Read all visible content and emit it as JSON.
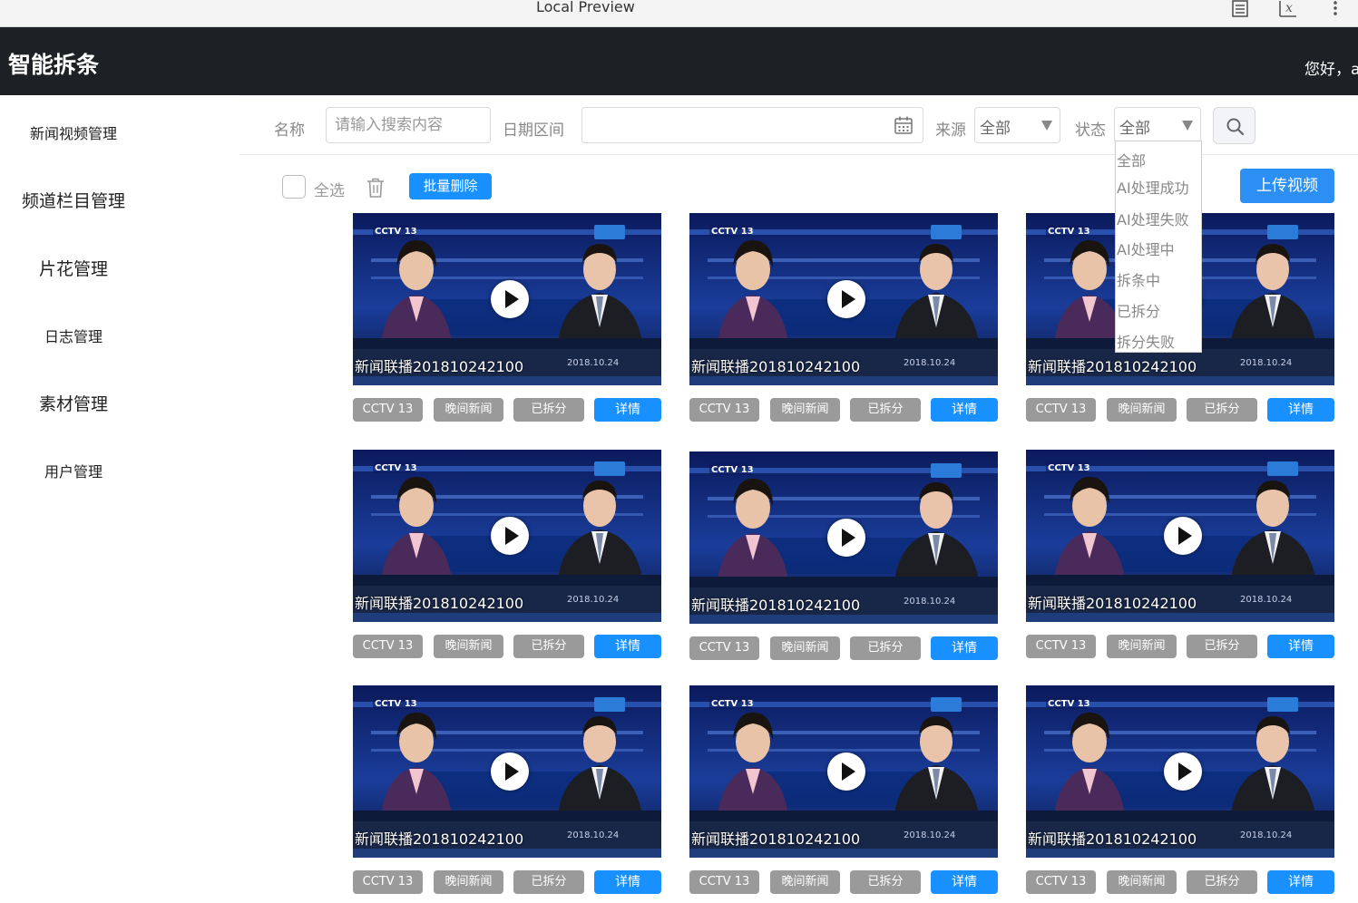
{
  "window": {
    "title": "Local Preview"
  },
  "header": {
    "brand": "智能拆条",
    "greeting": "您好，a"
  },
  "sidebar": {
    "items": [
      {
        "label": "新闻视频管理"
      },
      {
        "label": "频道栏目管理"
      },
      {
        "label": "片花管理"
      },
      {
        "label": "日志管理"
      },
      {
        "label": "素材管理"
      },
      {
        "label": "用户管理"
      }
    ]
  },
  "filters": {
    "name_label": "名称",
    "name_placeholder": "请输入搜索内容",
    "date_label": "日期区间",
    "source_label": "来源",
    "source_value": "全部",
    "status_label": "状态",
    "status_value": "全部",
    "status_options": [
      "全部",
      "AI处理成功",
      "AI处理失败",
      "AI处理中",
      "拆条中",
      "已拆分",
      "拆分失败"
    ]
  },
  "toolbar": {
    "select_all": "全选",
    "batch_delete": "批量删除",
    "upload": "上传视频"
  },
  "videos": [
    {
      "title": "新闻联播201810242100",
      "channel": "CCTV 13",
      "column": "晚间新闻",
      "status": "已拆分",
      "detail": "详情"
    },
    {
      "title": "新闻联播201810242100",
      "channel": "CCTV 13",
      "column": "晚间新闻",
      "status": "已拆分",
      "detail": "详情"
    },
    {
      "title": "新闻联播201810242100",
      "channel": "CCTV 13",
      "column": "晚间新闻",
      "status": "已拆分",
      "detail": "详情"
    },
    {
      "title": "新闻联播201810242100",
      "channel": "CCTV 13",
      "column": "晚间新闻",
      "status": "已拆分",
      "detail": "详情"
    },
    {
      "title": "新闻联播201810242100",
      "channel": "CCTV 13",
      "column": "晚间新闻",
      "status": "已拆分",
      "detail": "详情"
    },
    {
      "title": "新闻联播201810242100",
      "channel": "CCTV 13",
      "column": "晚间新闻",
      "status": "已拆分",
      "detail": "详情"
    },
    {
      "title": "新闻联播201810242100",
      "channel": "CCTV 13",
      "column": "晚间新闻",
      "status": "已拆分",
      "detail": "详情"
    },
    {
      "title": "新闻联播201810242100",
      "channel": "CCTV 13",
      "column": "晚间新闻",
      "status": "已拆分",
      "detail": "详情"
    },
    {
      "title": "新闻联播201810242100",
      "channel": "CCTV 13",
      "column": "晚间新闻",
      "status": "已拆分",
      "detail": "详情"
    }
  ],
  "colors": {
    "header_bg": "#1d2024",
    "primary": "#1890ff",
    "tag_gray": "#9a9a9a"
  },
  "icons": [
    "document-icon",
    "variable-icon",
    "more-vertical-icon",
    "calendar-icon",
    "search-icon",
    "trash-icon",
    "play-icon"
  ]
}
